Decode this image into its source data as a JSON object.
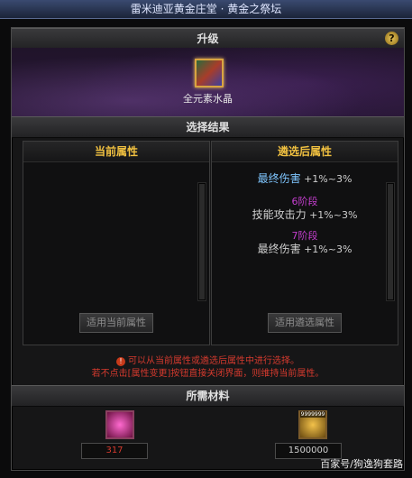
{
  "window": {
    "title": "雷米迪亚黄金庄堂 · 黄金之祭坛"
  },
  "upgrade": {
    "header": "升级",
    "help": "?",
    "item_name": "全元素水晶"
  },
  "select_result": {
    "header": "选择结果"
  },
  "current": {
    "title": "当前属性",
    "button": "适用当前属性"
  },
  "after": {
    "title": "遴选后属性",
    "line1_name": "最终伤害",
    "line1_value": "+1%~3%",
    "tier1": "6阶段",
    "line2_name": "技能攻击力",
    "line2_value": "+1%~3%",
    "tier2": "7阶段",
    "line3_name": "最终伤害",
    "line3_value": "+1%~3%",
    "button": "适用遴选属性"
  },
  "notice": {
    "line1": "可以从当前属性或遴选后属性中进行选择。",
    "line2": "若不点击[属性变更]按钮直接关闭界面，则维持当前属性。"
  },
  "materials": {
    "header": "所需材料",
    "item1_count": "317",
    "item2_badge": "9999999",
    "item2_count": "1500000"
  },
  "watermark": "百家号/狗逸狗套路",
  "colors": {
    "gold": "#f0c040",
    "tier": "#c63fd0",
    "notice": "#d43a2e",
    "attr_blue": "#7fc6ff"
  }
}
